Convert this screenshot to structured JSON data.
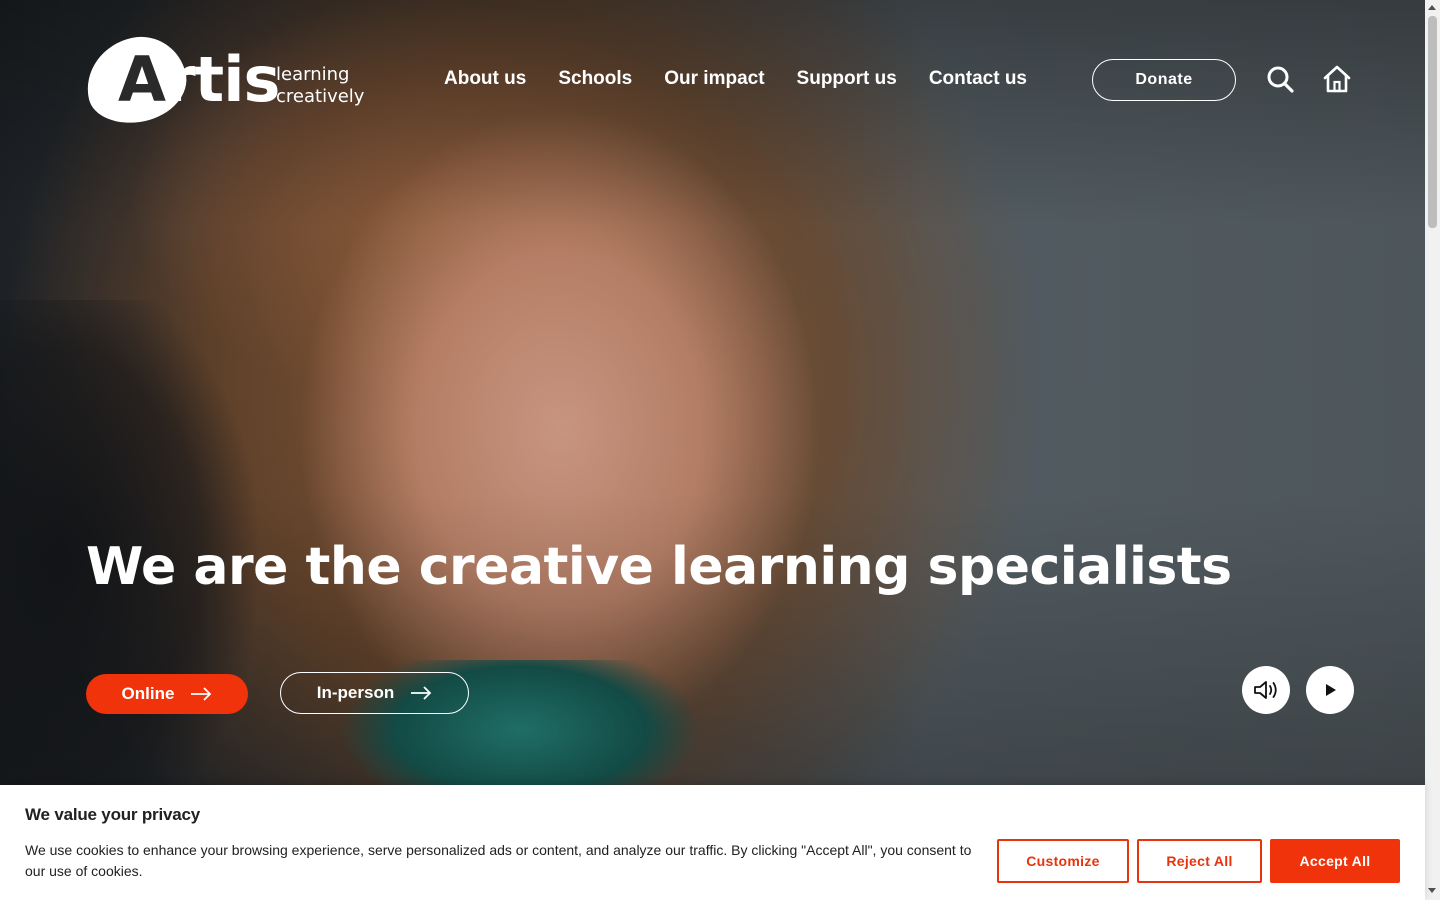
{
  "brand": {
    "wordmark_first": "A",
    "wordmark_rest": "rtis",
    "tagline_line1": "learning",
    "tagline_line2": "creatively"
  },
  "nav": {
    "items": [
      "About us",
      "Schools",
      "Our impact",
      "Support us",
      "Contact us"
    ]
  },
  "header": {
    "donate_label": "Donate",
    "search_icon": "search-icon",
    "home_icon": "home-icon"
  },
  "hero": {
    "headline": "We are the creative learning specialists",
    "primary_cta": "Online",
    "secondary_cta": "In-person",
    "controls": {
      "sound_icon": "speaker-icon",
      "play_icon": "play-icon"
    }
  },
  "cookie": {
    "title": "We value your privacy",
    "text": "We use cookies to enhance your browsing experience, serve personalized ads or content, and analyze our traffic. By clicking \"Accept All\", you consent to our use of cookies.",
    "customize_label": "Customize",
    "reject_label": "Reject All",
    "accept_label": "Accept All"
  },
  "colors": {
    "accent": "#f0330a",
    "banner_bg": "#ffffff",
    "text_dark": "#212121"
  }
}
